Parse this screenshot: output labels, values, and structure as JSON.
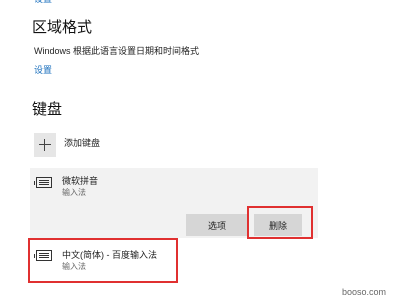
{
  "top_link": "设置",
  "region": {
    "title": "区域格式",
    "description": "Windows 根据此语言设置日期和时间格式",
    "link": "设置"
  },
  "keyboard": {
    "title": "键盘",
    "add_label": "添加键盘",
    "items": [
      {
        "name": "微软拼音",
        "type": "输入法"
      },
      {
        "name": "中文(简体) - 百度输入法",
        "type": "输入法"
      }
    ],
    "options_button": "选项",
    "delete_button": "删除"
  },
  "highlight_color": "#e03030",
  "watermark": "booso.com"
}
